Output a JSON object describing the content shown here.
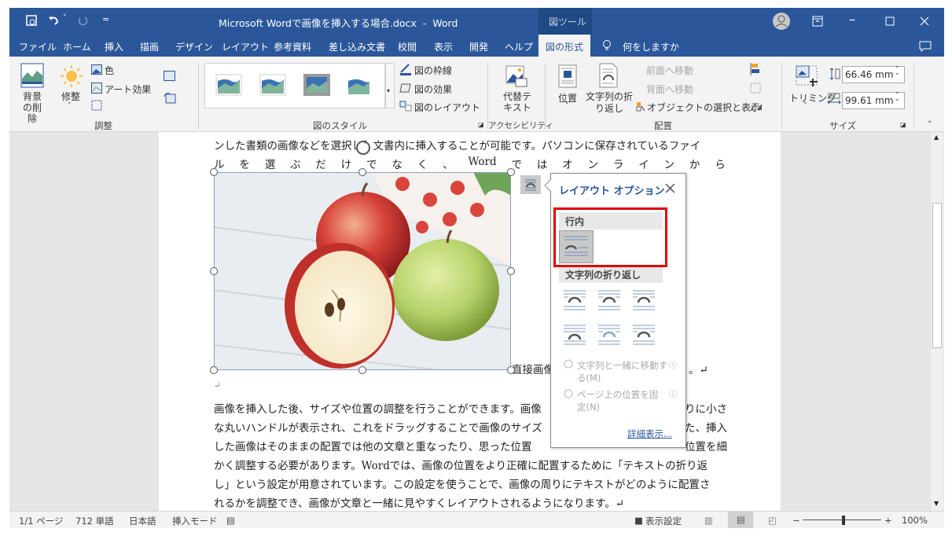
{
  "window": {
    "title": "Microsoft Wordで画像を挿入する場合.docx  -  Word",
    "context_tab_group": "図ツール",
    "qat": {
      "save": "save-icon",
      "undo": "undo-icon",
      "redo": "redo-icon",
      "customize": "="
    }
  },
  "tabs": [
    {
      "label": "ファイル"
    },
    {
      "label": "ホーム"
    },
    {
      "label": "挿入"
    },
    {
      "label": "描画"
    },
    {
      "label": "デザイン"
    },
    {
      "label": "レイアウト"
    },
    {
      "label": "参考資料"
    },
    {
      "label": "差し込み文書"
    },
    {
      "label": "校閲"
    },
    {
      "label": "表示"
    },
    {
      "label": "開発"
    },
    {
      "label": "ヘルプ"
    },
    {
      "label": "図の形式",
      "active": true
    }
  ],
  "tell_me": "何をしますか",
  "ribbon": {
    "adjust": {
      "remove_bg": "背景の削除",
      "corrections": "修整",
      "color": "色",
      "art_effects": "アート効果",
      "group": "調整"
    },
    "styles": {
      "border": "図の枠線",
      "effects": "図の効果",
      "layout": "図のレイアウト",
      "group": "図のスタイル"
    },
    "accessibility": {
      "alt_text": "代替テキスト",
      "group": "アクセシビリティ"
    },
    "arrange": {
      "position": "位置",
      "wrap_text": "文字列の折り返し",
      "bring_forward": "前面へ移動",
      "send_backward": "背面へ移動",
      "selection_pane": "オブジェクトの選択と表示",
      "group": "配置"
    },
    "size": {
      "crop": "トリミング",
      "height": "66.46 mm",
      "width": "99.61 mm",
      "group": "サイズ"
    }
  },
  "document": {
    "lines": [
      "ンした書類の画像などを選択し、文書内に挿入することが可能です。パソコンに保存されているファイ",
      [
        "ル",
        "を",
        "選",
        "ぶ",
        "だ",
        "け",
        "で",
        "な",
        "く",
        "、",
        "Word",
        "で",
        "は",
        "オ",
        "ン",
        "ラ",
        "イ",
        "ン",
        "か",
        "ら"
      ],
      {
        "left": "直接画像",
        "right": "。↵"
      },
      "↵",
      {
        "left": "画像を挿入した後、サイズや位置の調整を行うことができます。画像",
        "right": "りに小さ"
      },
      {
        "left": "な丸いハンドルが表示され、これをドラッグすることで画像のサイズ",
        "right": "た、挿入"
      },
      {
        "left": "した画像はそのままの配置では他の文章と重なったり、思った位置",
        "right": "位置を細"
      },
      "かく調整する必要があります。Wordでは、画像の位置をより正確に配置するために「テキストの折り返",
      "し」という設定が用意されています。この設定を使うことで、画像の周りにテキストがどのように配置さ",
      "れるかを調整でき、画像が文章と一緒に見やすくレイアウトされるようになります。↵"
    ]
  },
  "layout_popup": {
    "title": "レイアウト オプション",
    "inline_header": "行内",
    "wrap_header": "文字列の折り返し",
    "move_with_text": "文字列と一緒に移動する(M)",
    "fix_position": "ページ上の位置を固定(N)",
    "more": "詳細表示...",
    "highlight_color": "#e00000"
  },
  "status": {
    "page": "1/1 ページ",
    "words": "712 単語",
    "language": "日本語",
    "mode": "挿入モード",
    "display_settings": "表示設定",
    "zoom": "100%",
    "zoom_level": 100
  },
  "colors": {
    "accent": "#2b579a",
    "ribbon": "#f3f3f3"
  }
}
